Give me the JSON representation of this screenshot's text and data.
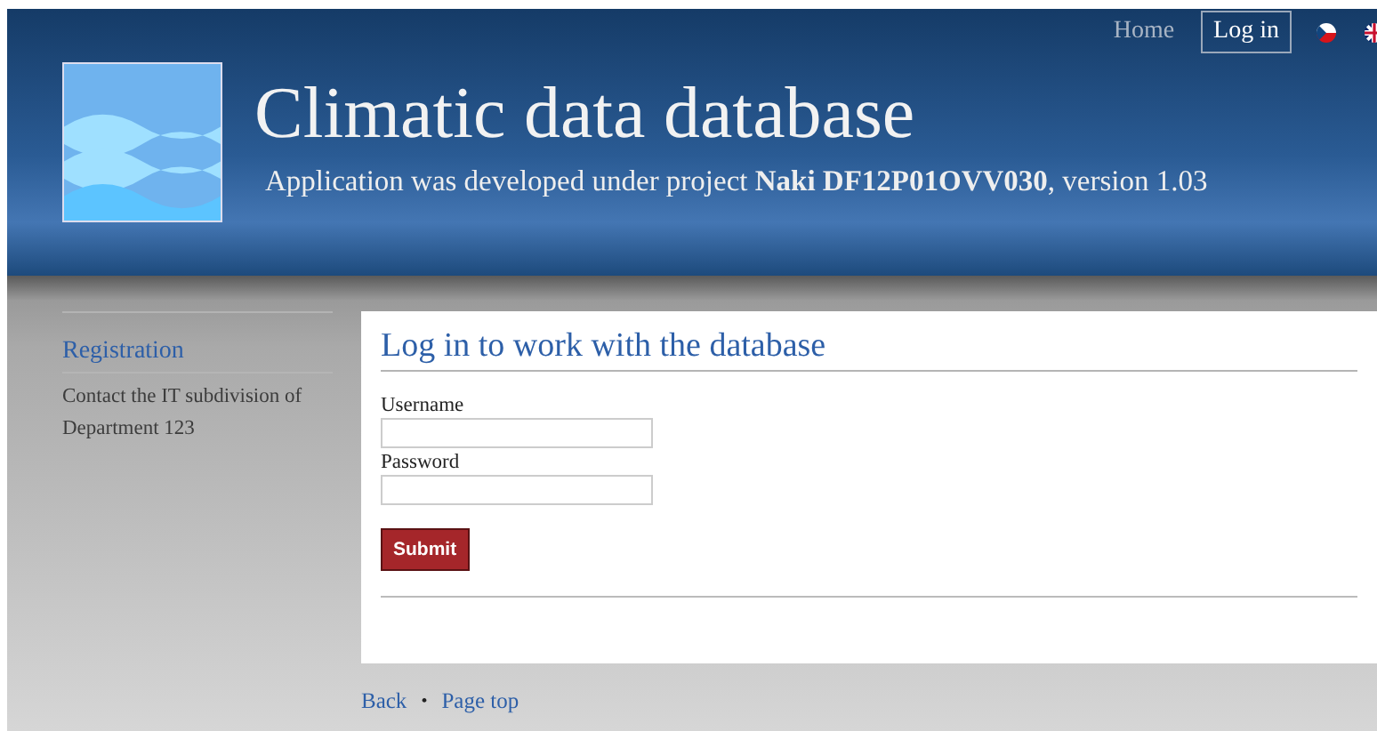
{
  "nav": [
    {
      "label": "Home",
      "selected": false
    },
    {
      "label": "Log in",
      "selected": true
    }
  ],
  "languages": [
    {
      "kind": "cz"
    },
    {
      "kind": "uk"
    }
  ],
  "header": {
    "title": "Climatic data database",
    "subtitle": "Application was developed under project **Naki DF12P01OVV030**, version 1.03"
  },
  "sidebar": {
    "title": "Registration",
    "text": "Contact the IT subdivision of Department 123"
  },
  "form": {
    "heading": "Log in to work with the database",
    "fields": [
      {
        "label": "Username"
      },
      {
        "label": "Password"
      }
    ],
    "submit": "Submit"
  },
  "footer": {
    "links": [
      "Back",
      "Page top"
    ],
    "separator": "•"
  }
}
